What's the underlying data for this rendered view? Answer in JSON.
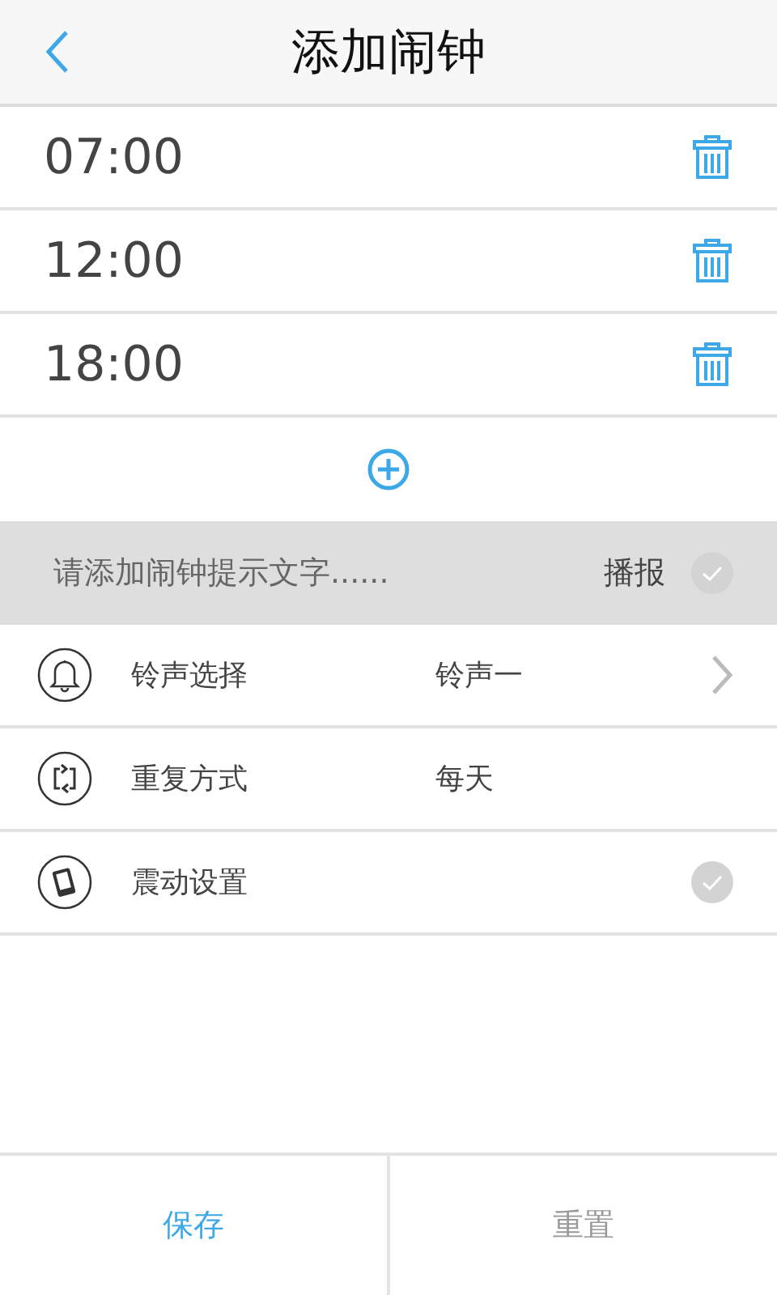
{
  "header": {
    "title": "添加闹钟"
  },
  "alarms": [
    {
      "time": "07:00"
    },
    {
      "time": "12:00"
    },
    {
      "time": "18:00"
    }
  ],
  "prompt": {
    "placeholder": "请添加闹钟提示文字......",
    "label": "播报",
    "checked": false
  },
  "settings": [
    {
      "kind": "link",
      "label": "铃声选择",
      "value": "铃声一"
    },
    {
      "kind": "value",
      "label": "重复方式",
      "value": "每天"
    },
    {
      "kind": "toggle",
      "label": "震动设置",
      "checked": false
    }
  ],
  "buttons": [
    {
      "label": "保存",
      "primary": true
    },
    {
      "label": "重置",
      "primary": false
    }
  ]
}
